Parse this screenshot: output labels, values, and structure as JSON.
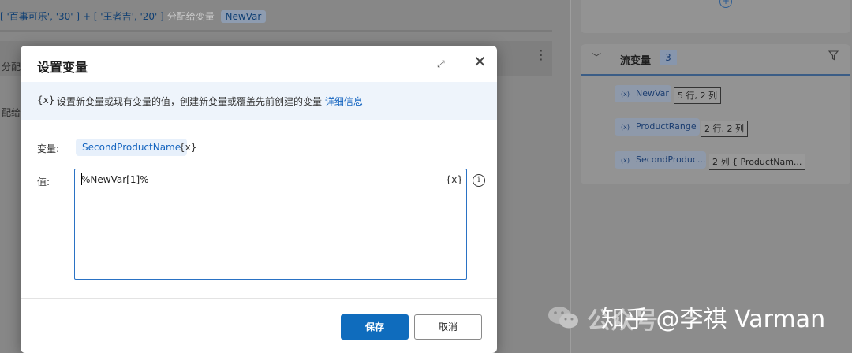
{
  "background": {
    "action_line": {
      "part1": "[ '百事可乐', '30' ] + [ '王者吉', '20' ]",
      "part2": "分配给变量",
      "var_chip": "NewVar"
    },
    "fragment_1": "分配",
    "fragment_2": "配给"
  },
  "flow_variables": {
    "title": "流变量",
    "count": "3",
    "items": [
      {
        "icon": "(x)",
        "name": "NewVar",
        "info": "5 行, 2 列"
      },
      {
        "icon": "(x)",
        "name": "ProductRange",
        "info": "2 行, 2 列"
      },
      {
        "icon": "(x)",
        "name": "SecondProduc...",
        "info": "2 列 { ProductNam..."
      }
    ]
  },
  "dialog": {
    "title": "设置变量",
    "info_icon": "{x}",
    "info_text": "设置新变量或现有变量的值，创建新变量或覆盖先前创建的变量",
    "info_link": "详细信息",
    "variable_label": "变量:",
    "variable_name": "SecondProductName",
    "variable_icon": "{x}",
    "value_label": "值:",
    "value_text": "%NewVar[1]%",
    "value_var_icon": "{x}",
    "value_info_icon": "i",
    "save_label": "保存",
    "cancel_label": "取消"
  },
  "watermark": {
    "bg_text": "公众号",
    "text": "知乎 @李祺 Varman"
  }
}
